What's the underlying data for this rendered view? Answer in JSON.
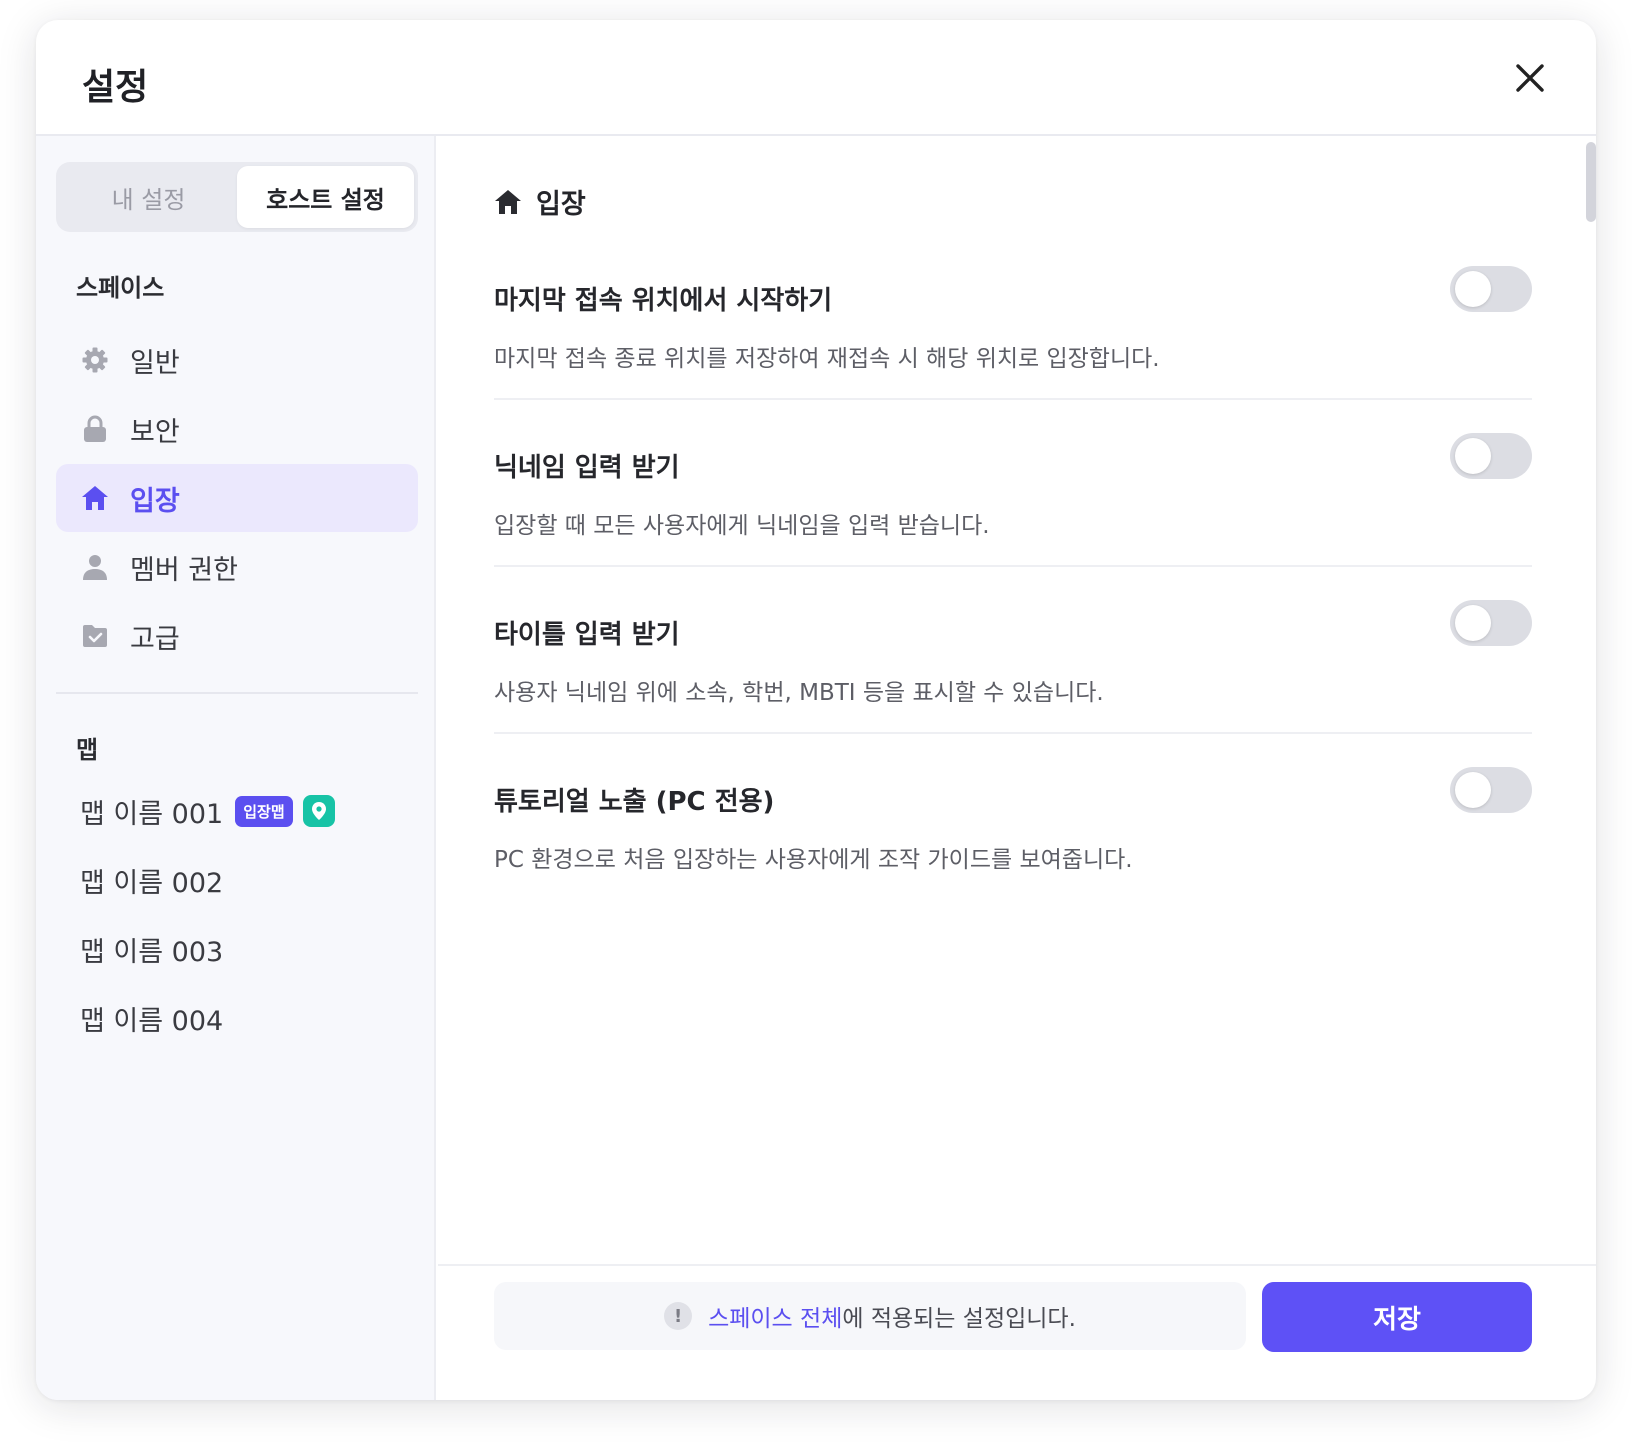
{
  "modal": {
    "title": "설정"
  },
  "tabs": [
    {
      "label": "내 설정",
      "active": false
    },
    {
      "label": "호스트 설정",
      "active": true
    }
  ],
  "sidebar": {
    "space_section": "스페이스",
    "space_items": [
      {
        "label": "일반",
        "icon": "gear-icon"
      },
      {
        "label": "보안",
        "icon": "lock-icon"
      },
      {
        "label": "입장",
        "icon": "home-icon",
        "active": true
      },
      {
        "label": "멤버 권한",
        "icon": "person-icon"
      },
      {
        "label": "고급",
        "icon": "folder-check-icon"
      }
    ],
    "map_section": "맵",
    "map_items": [
      {
        "label": "맵 이름 001",
        "badge": "입장맵",
        "pin": true
      },
      {
        "label": "맵 이름 002"
      },
      {
        "label": "맵 이름 003"
      },
      {
        "label": "맵 이름 004"
      }
    ]
  },
  "main": {
    "heading": "입장",
    "settings": [
      {
        "title": "마지막 접속 위치에서 시작하기",
        "desc": "마지막 접속 종료 위치를 저장하여 재접속 시 해당 위치로 입장합니다.",
        "enabled": false
      },
      {
        "title": "닉네임 입력 받기",
        "desc": "입장할 때 모든 사용자에게 닉네임을 입력 받습니다.",
        "enabled": false
      },
      {
        "title": "타이틀 입력 받기",
        "desc": "사용자 닉네임 위에 소속, 학번, MBTI 등을 표시할 수 있습니다.",
        "enabled": false
      },
      {
        "title": "튜토리얼 노출 (PC 전용)",
        "desc": "PC 환경으로 처음 입장하는 사용자에게 조작 가이드를 보여줍니다.",
        "enabled": false
      }
    ]
  },
  "footer": {
    "notice_icon": "!",
    "notice_link": "스페이스 전체",
    "notice_text": "에 적용되는 설정입니다.",
    "save_label": "저장"
  },
  "colors": {
    "accent": "#5e51f6",
    "active_bg": "#ebe8fd",
    "pin_badge": "#17c3a6",
    "toggle_off": "#dcdde3"
  }
}
